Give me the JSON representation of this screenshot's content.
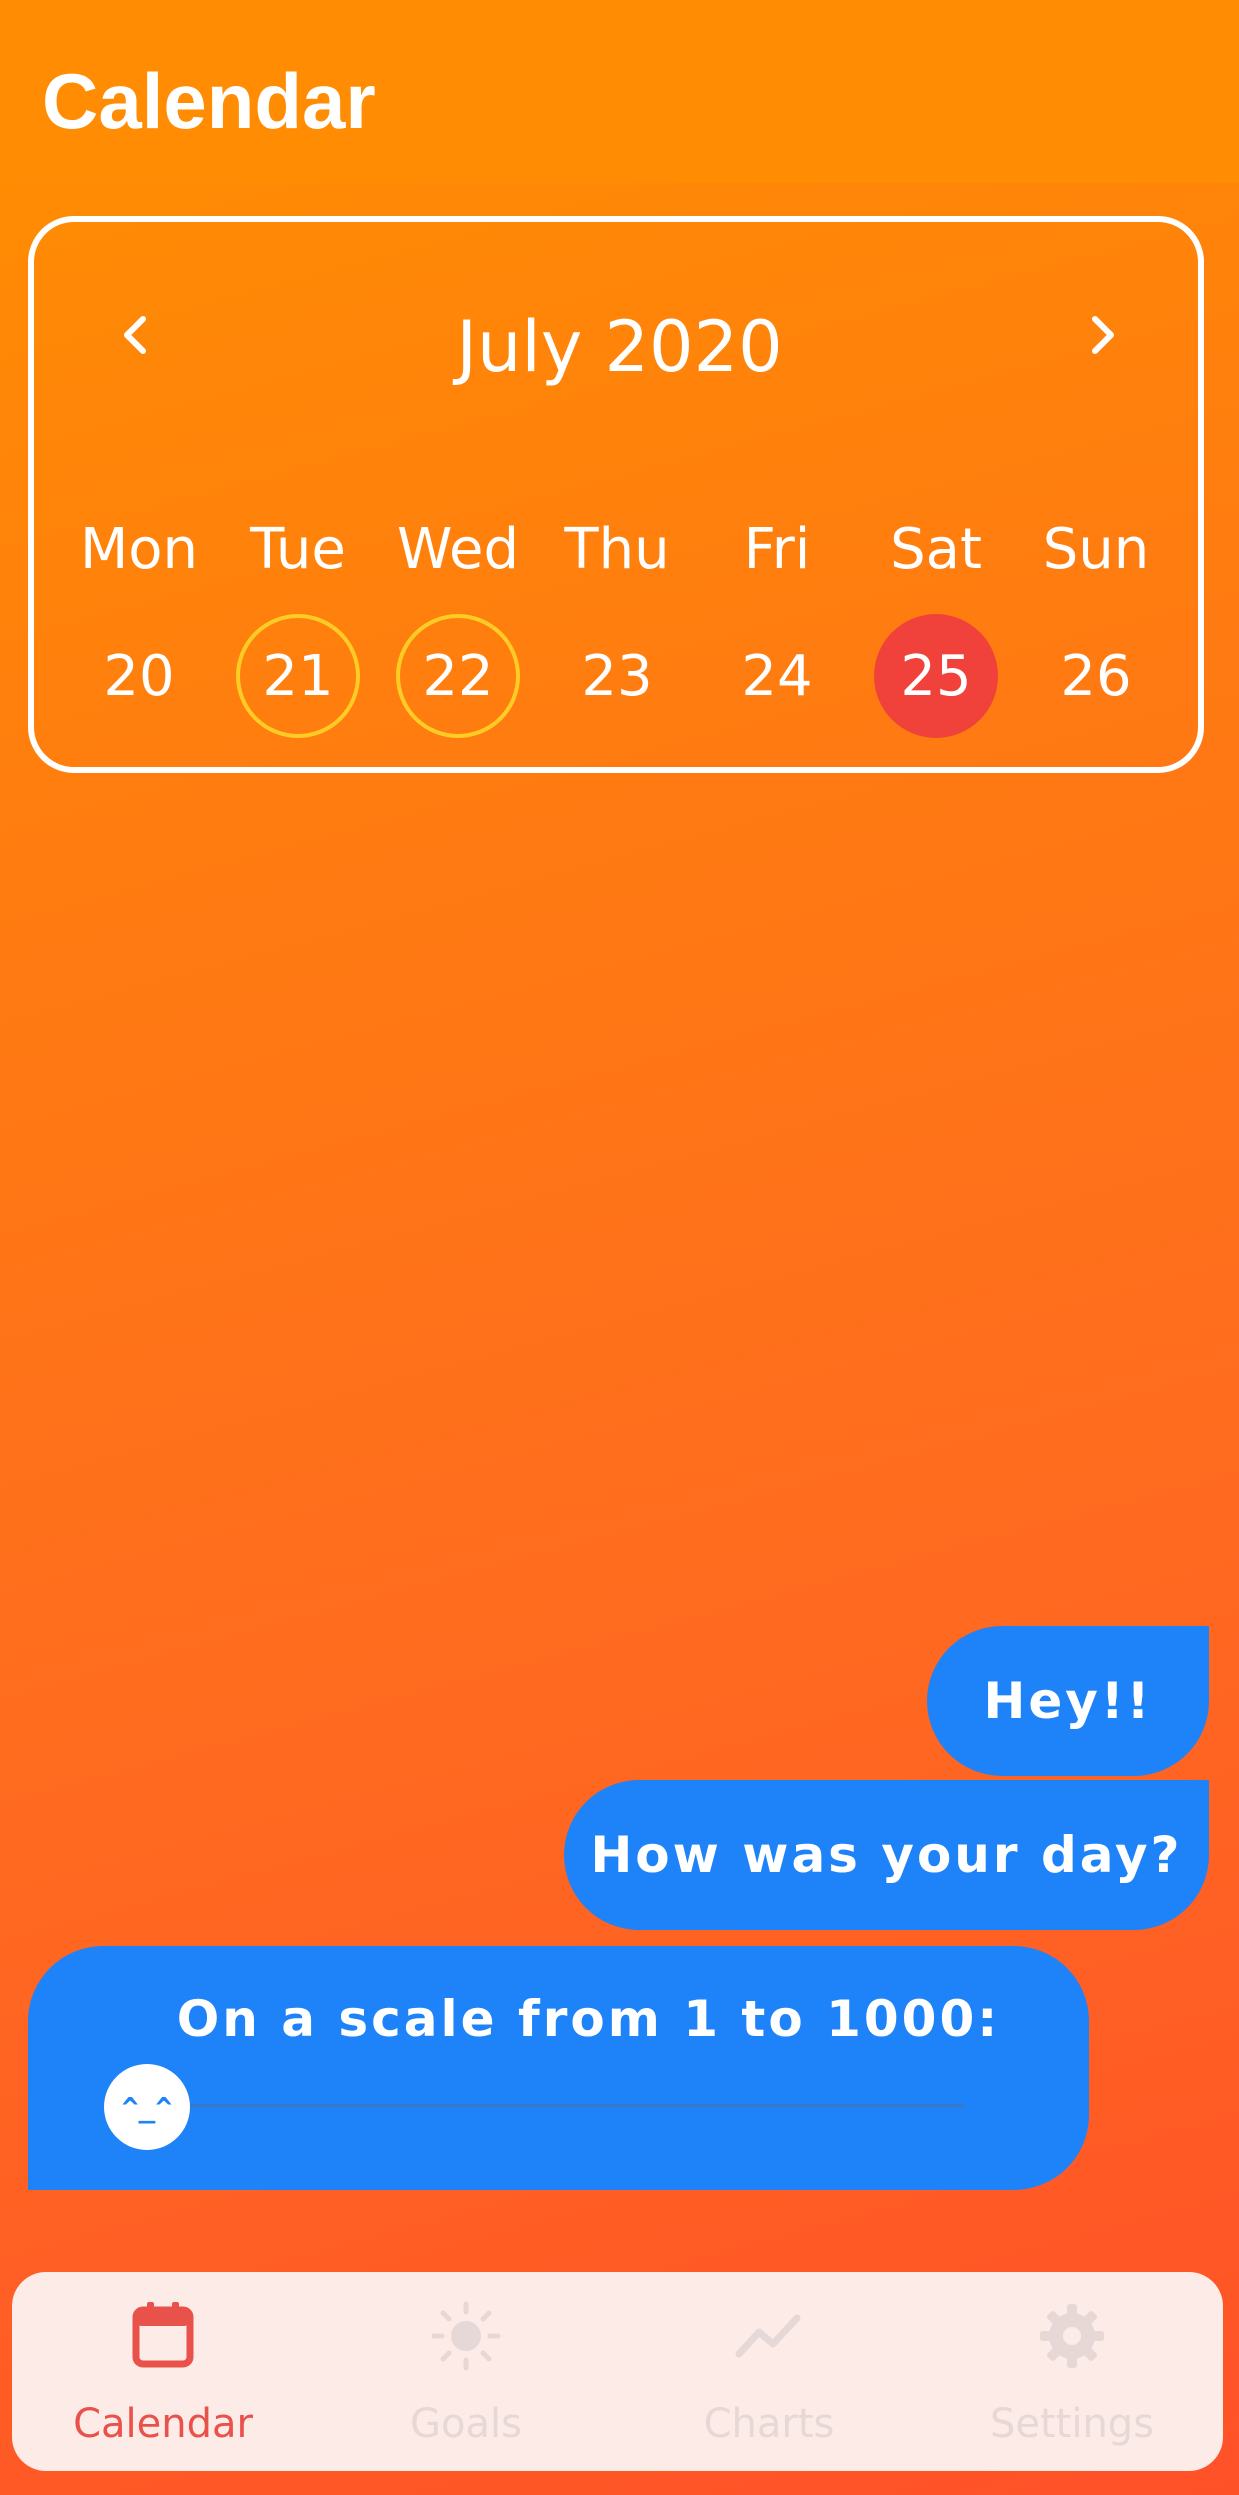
{
  "header": {
    "title": "Calendar"
  },
  "calendar": {
    "month_title": "July 2020",
    "prev_icon": "chevron-left-icon",
    "next_icon": "chevron-right-icon",
    "weekdays": [
      "Mon",
      "Tue",
      "Wed",
      "Thu",
      "Fri",
      "Sat",
      "Sun"
    ],
    "days": [
      "20",
      "21",
      "22",
      "23",
      "24",
      "25",
      "26"
    ],
    "ringed_days": [
      "21",
      "22"
    ],
    "selected_day": "25",
    "ring_color": "#ffcc26",
    "selected_color": "#f0413a"
  },
  "chat": {
    "greeting": "Hey!!",
    "question": "How was your day?",
    "scale_prompt": "On a scale from 1 to 1000:",
    "slider": {
      "thumb_face": "^_^",
      "value_fraction": 0.0
    },
    "bubble_color": "#1e83f8"
  },
  "bottom_nav": {
    "items": [
      {
        "label": "Calendar",
        "icon": "calendar-icon",
        "active": true
      },
      {
        "label": "Goals",
        "icon": "sun-icon",
        "active": false
      },
      {
        "label": "Charts",
        "icon": "trend-chart-icon",
        "active": false
      },
      {
        "label": "Settings",
        "icon": "gear-icon",
        "active": false
      }
    ],
    "active_color": "#e9524a",
    "inactive_color": "#e6d8d6"
  }
}
